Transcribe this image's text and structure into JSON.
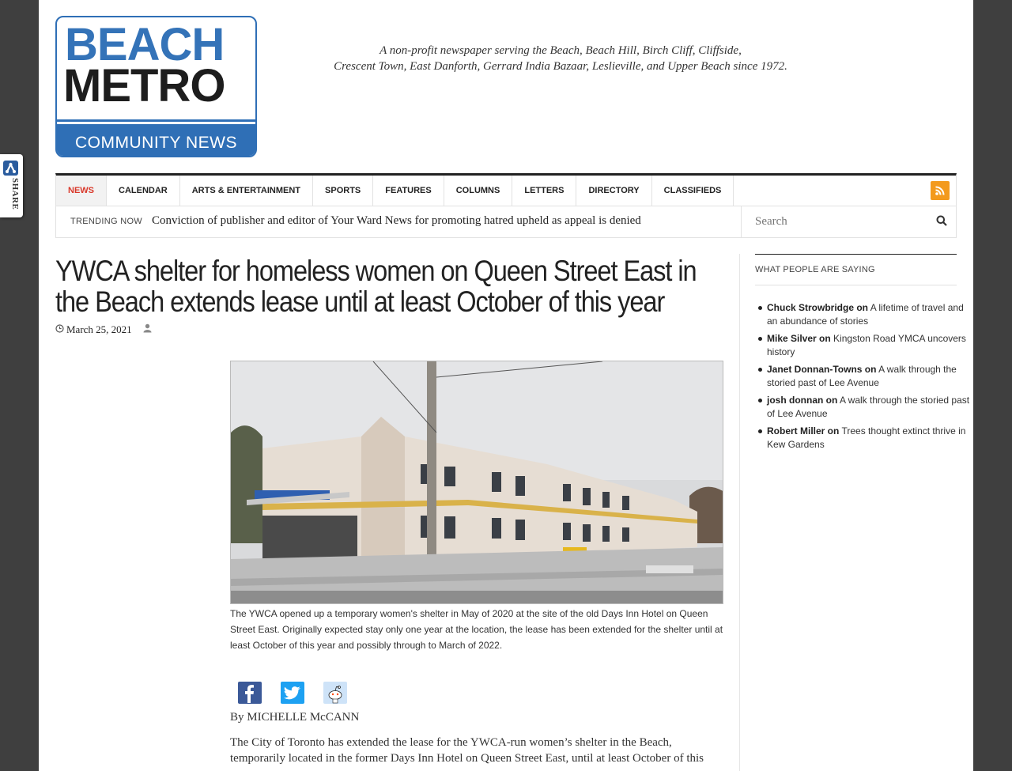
{
  "share_widget": {
    "label": "SHARE",
    "icon": "share-icon"
  },
  "header": {
    "logo": {
      "line1": "BEACH",
      "line2": "METRO",
      "line3": "COMMUNITY NEWS"
    },
    "tagline_line1": "A non-profit newspaper serving the Beach, Beach Hill, Birch Cliff, Cliffside,",
    "tagline_line2": "Crescent Town, East Danforth, Gerrard India Bazaar, Leslieville, and Upper Beach since 1972."
  },
  "nav": {
    "items": [
      {
        "label": "NEWS",
        "active": true
      },
      {
        "label": "CALENDAR"
      },
      {
        "label": "ARTS & ENTERTAINMENT"
      },
      {
        "label": "SPORTS"
      },
      {
        "label": "FEATURES"
      },
      {
        "label": "COLUMNS"
      },
      {
        "label": "LETTERS"
      },
      {
        "label": "DIRECTORY"
      },
      {
        "label": "CLASSIFIEDS"
      }
    ],
    "rss_icon": "rss-icon"
  },
  "trending": {
    "label": "TRENDING NOW",
    "headline": "Conviction of publisher and editor of Your Ward News for promoting hatred upheld as appeal is denied"
  },
  "search": {
    "placeholder": "Search"
  },
  "article": {
    "title": "YWCA shelter for homeless women on Queen Street East in the Beach extends lease until at least October of this year",
    "date": "March 25, 2021",
    "caption": "The YWCA opened up a temporary women's shelter in May of 2020 at the site of the old Days Inn Hotel on Queen Street East. Originally expected stay only one year at the location, the lease has been extended for the shelter until at least October of this year and possibly through to March of 2022.",
    "byline": "By MICHELLE McCANN",
    "body": "The City of Toronto has extended the lease for the YWCA-run women’s shelter in the Beach, temporarily located in the former Days Inn Hotel on Queen Street East, until at least October of this"
  },
  "sidebar": {
    "title": "WHAT PEOPLE ARE SAYING",
    "comments": [
      {
        "author": "Chuck Strowbridge on",
        "post": "A lifetime of travel and an abundance of stories"
      },
      {
        "author": "Mike Silver on",
        "post": "Kingston Road YMCA uncovers history"
      },
      {
        "author": "Janet Donnan-Towns on",
        "post": "A walk through the storied past of Lee Avenue"
      },
      {
        "author": "josh donnan on",
        "post": "A walk through the storied past of Lee Avenue"
      },
      {
        "author": "Robert Miller on",
        "post": "Trees thought extinct thrive in Kew Gardens"
      }
    ]
  },
  "colors": {
    "brand_blue": "#2f6fb6",
    "active_nav": "#d9382a",
    "rss": "#f39a1d",
    "facebook": "#3b5998",
    "twitter": "#1da1f2"
  }
}
